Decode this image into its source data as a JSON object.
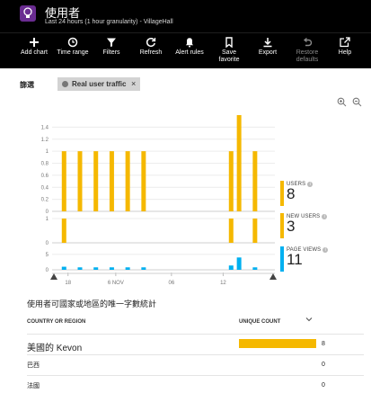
{
  "header": {
    "title": "使用者",
    "subtitle": "Last 24 hours (1 hour granularity) - VillageHall"
  },
  "toolbar": {
    "items": [
      {
        "label": "Add chart",
        "icon": "plus-icon"
      },
      {
        "label": "Time range",
        "icon": "clock-icon"
      },
      {
        "label": "Filters",
        "icon": "funnel-icon"
      },
      {
        "label": "Refresh",
        "icon": "refresh-icon"
      },
      {
        "label": "Alert rules",
        "icon": "bell-icon"
      },
      {
        "label": "Save favorite",
        "line1": "Save",
        "line2": "favorite",
        "icon": "bookmark-icon"
      },
      {
        "label": "Export",
        "icon": "download-icon"
      },
      {
        "label": "Restore defaults",
        "line1": "Restore",
        "line2": "defaults",
        "icon": "undo-icon",
        "disabled": true
      },
      {
        "label": "Help",
        "icon": "external-link-icon"
      }
    ]
  },
  "filter": {
    "label": "篩選",
    "chip": "Real user traffic",
    "chip_close": "×"
  },
  "chart_data": [
    {
      "type": "bar",
      "name": "USERS",
      "y_ticks": [
        "1.4",
        "1.2",
        "1",
        "0.8",
        "0.6",
        "0.4",
        "0.2",
        "0"
      ],
      "ylim": [
        0,
        1.6
      ],
      "color": "#f5b800",
      "values": [
        1,
        1,
        1,
        1,
        1,
        1,
        1,
        1,
        1,
        1,
        1,
        1,
        1,
        1,
        1,
        1,
        1,
        1,
        1,
        1,
        1,
        1,
        1,
        1,
        1,
        1,
        1,
        1,
        1,
        1,
        1,
        1,
        1,
        1,
        1,
        1,
        1,
        1,
        1,
        1,
        1,
        1,
        1,
        1,
        1,
        1,
        1,
        1,
        1,
        1,
        1,
        1,
        1,
        1
      ],
      "bars": [
        {
          "x": 1,
          "y": 1
        },
        {
          "x": 3,
          "y": 1
        },
        {
          "x": 5,
          "y": 1
        },
        {
          "x": 7,
          "y": 1
        },
        {
          "x": 9,
          "y": 1
        },
        {
          "x": 11,
          "y": 1
        },
        {
          "x": 22,
          "y": 1
        },
        {
          "x": 23,
          "y": 1.6
        },
        {
          "x": 25,
          "y": 1
        }
      ],
      "total_label": "USERS",
      "total": "8"
    },
    {
      "type": "bar",
      "name": "NEW USERS",
      "y_ticks": [
        "1",
        "0"
      ],
      "ylim": [
        0,
        1
      ],
      "color": "#f5b800",
      "bars": [
        {
          "x": 1,
          "y": 1
        },
        {
          "x": 22,
          "y": 1
        },
        {
          "x": 25,
          "y": 1
        }
      ],
      "total_label": "NEW USERS",
      "total": "3"
    },
    {
      "type": "bar",
      "name": "PAGE VIEWS",
      "y_ticks": [
        "5",
        "0"
      ],
      "ylim": [
        0,
        7
      ],
      "color": "#00b0f0",
      "bars": [
        {
          "x": 1,
          "y": 1
        },
        {
          "x": 3,
          "y": 0.8
        },
        {
          "x": 5,
          "y": 0.8
        },
        {
          "x": 7,
          "y": 0.8
        },
        {
          "x": 9,
          "y": 0.8
        },
        {
          "x": 11,
          "y": 0.8
        },
        {
          "x": 22,
          "y": 1.4
        },
        {
          "x": 23,
          "y": 4
        },
        {
          "x": 25,
          "y": 0.8
        }
      ],
      "total_label": "PAGE VIEWS",
      "total": "11"
    }
  ],
  "x_axis": {
    "ticks": [
      {
        "x": 2,
        "label": "18"
      },
      {
        "x": 8,
        "label": "6 NOV"
      },
      {
        "x": 15,
        "label": "06"
      },
      {
        "x": 21.5,
        "label": "12"
      }
    ],
    "n_slots": 28
  },
  "table": {
    "title": "使用者可國家或地區的唯一字數統計",
    "col_country": "COUNTRY OR REGION",
    "col_count": "UNIQUE COUNT",
    "rows": [
      {
        "country": "美國的 Kevon",
        "count": "8",
        "fraction": 1
      },
      {
        "country": "巴西",
        "count": "0",
        "fraction": 0
      },
      {
        "country": "法國",
        "count": "0",
        "fraction": 0
      }
    ]
  }
}
